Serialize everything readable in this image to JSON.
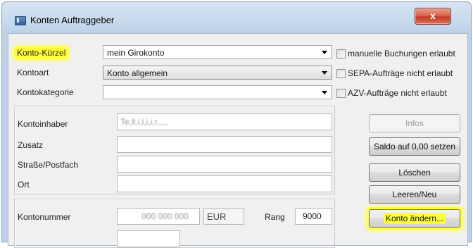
{
  "window": {
    "title": "Konten Auftraggeber",
    "close_glyph": "x"
  },
  "fields": {
    "konto_kuerzel": {
      "label": "Konto-Kürzel",
      "value": "mein Girokonto"
    },
    "kontoart": {
      "label": "Kontoart",
      "value": "Konto allgemein"
    },
    "kontokategorie": {
      "label": "Kontokategorie",
      "value": ""
    }
  },
  "checkboxes": [
    {
      "label": "manuelle Buchungen erlaubt",
      "checked": false
    },
    {
      "label": "SEPA-Aufträge nicht erlaubt",
      "checked": false
    },
    {
      "label": "AZV-Aufträge nicht erlaubt",
      "checked": false
    }
  ],
  "address": {
    "kontoinhaber_label": "Kontoinhaber",
    "kontoinhaber_value": "Te,ll,i,l,i,i,r,,,,,",
    "zusatz_label": "Zusatz",
    "strasse_label": "Straße/Postfach",
    "ort_label": "Ort"
  },
  "account": {
    "kontonummer_label": "Kontonummer",
    "kontonummer_value": "000 000 000",
    "currency": "EUR",
    "rang_label": "Rang",
    "rang_value": "9000"
  },
  "buttons": {
    "infos": "Infos",
    "saldo": "Saldo auf 0,00 setzen",
    "loeschen": "Löschen",
    "leeren": "Leeren/Neu",
    "konto_aendern": "Konto ändern..."
  }
}
